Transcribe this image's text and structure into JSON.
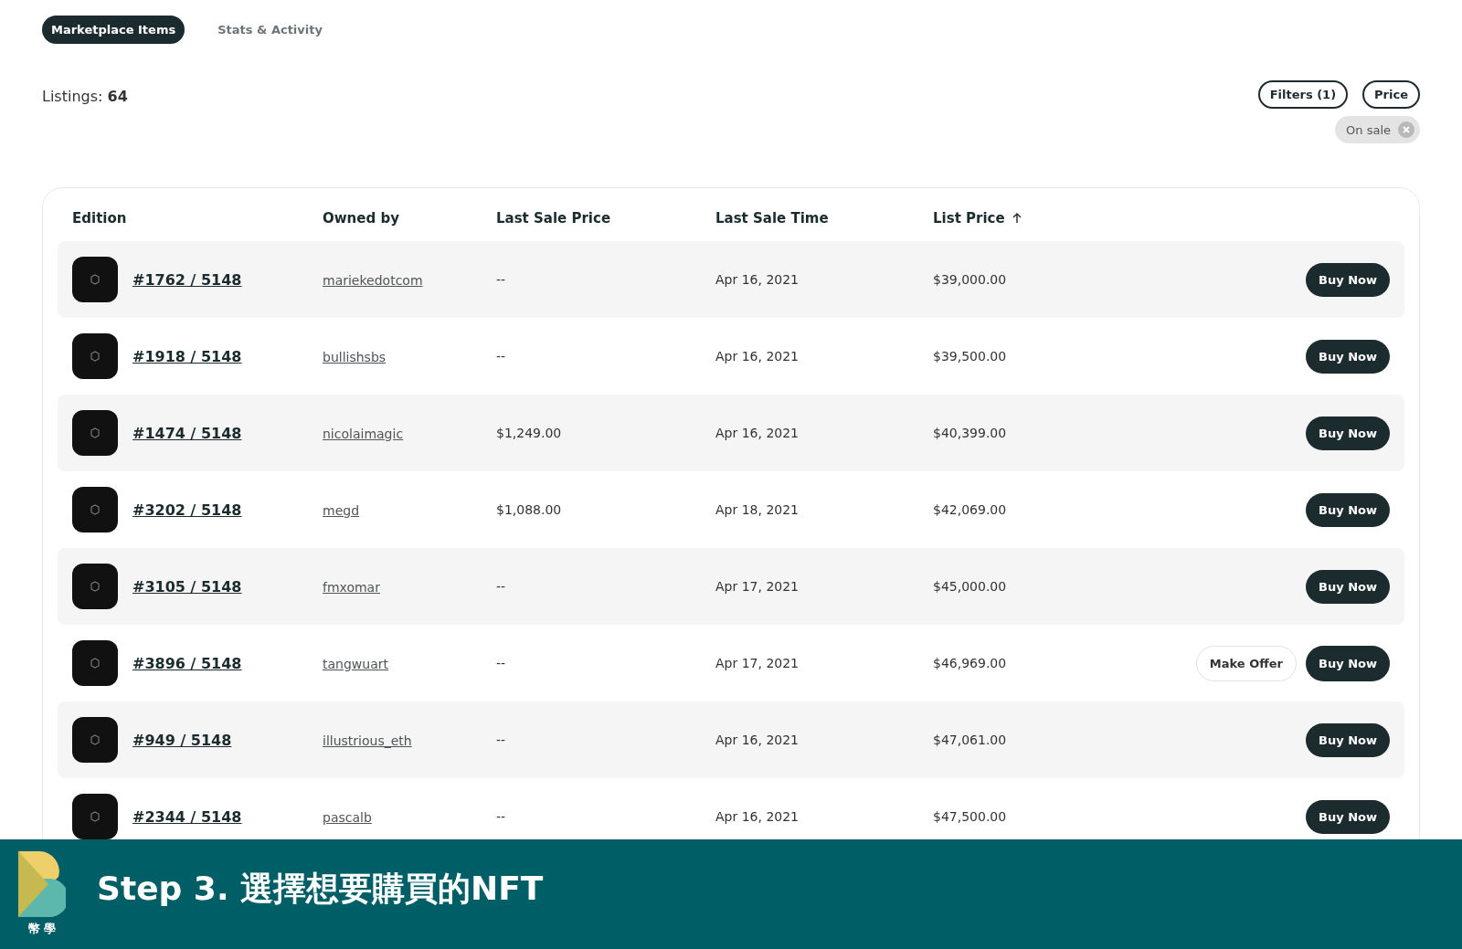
{
  "tabs": [
    {
      "label": "Marketplace Items",
      "selected": true
    },
    {
      "label": "Stats & Activity",
      "selected": false
    }
  ],
  "listings": {
    "label": "Listings:",
    "count": "64"
  },
  "filter_buttons": [
    "Filters (1)",
    "Price"
  ],
  "active_filters": [
    {
      "label": "On sale"
    }
  ],
  "table": {
    "columns": [
      {
        "label": "Edition",
        "sorted": false
      },
      {
        "label": "Owned by",
        "sorted": false
      },
      {
        "label": "Last Sale Price",
        "sorted": false
      },
      {
        "label": "Last Sale Time",
        "sorted": false
      },
      {
        "label": "List Price",
        "sorted": true
      }
    ],
    "rows": [
      {
        "edition": "#1762 / 5148",
        "owner": "mariekedotcom",
        "last_sale_price": "--",
        "last_sale_time": "Apr 16, 2021",
        "list_price": "$39,000.00",
        "actions": [
          {
            "kind": "primary",
            "label": "Buy Now"
          }
        ]
      },
      {
        "edition": "#1918 / 5148",
        "owner": "bullishsbs",
        "last_sale_price": "--",
        "last_sale_time": "Apr 16, 2021",
        "list_price": "$39,500.00",
        "actions": [
          {
            "kind": "primary",
            "label": "Buy Now"
          }
        ]
      },
      {
        "edition": "#1474 / 5148",
        "owner": "nicolaimagic",
        "last_sale_price": "$1,249.00",
        "last_sale_time": "Apr 16, 2021",
        "list_price": "$40,399.00",
        "actions": [
          {
            "kind": "primary",
            "label": "Buy Now"
          }
        ]
      },
      {
        "edition": "#3202 / 5148",
        "owner": "megd",
        "last_sale_price": "$1,088.00",
        "last_sale_time": "Apr 18, 2021",
        "list_price": "$42,069.00",
        "actions": [
          {
            "kind": "primary",
            "label": "Buy Now"
          }
        ]
      },
      {
        "edition": "#3105 / 5148",
        "owner": "fmxomar",
        "last_sale_price": "--",
        "last_sale_time": "Apr 17, 2021",
        "list_price": "$45,000.00",
        "actions": [
          {
            "kind": "primary",
            "label": "Buy Now"
          }
        ]
      },
      {
        "edition": "#3896 / 5148",
        "owner": "tangwuart",
        "last_sale_price": "--",
        "last_sale_time": "Apr 17, 2021",
        "list_price": "$46,969.00",
        "actions": [
          {
            "kind": "outline",
            "label": "Make Offer"
          },
          {
            "kind": "primary",
            "label": "Buy Now"
          }
        ]
      },
      {
        "edition": "#949 / 5148",
        "owner": "illustrious_eth",
        "last_sale_price": "--",
        "last_sale_time": "Apr 16, 2021",
        "list_price": "$47,061.00",
        "actions": [
          {
            "kind": "primary",
            "label": "Buy Now"
          }
        ]
      },
      {
        "edition": "#2344 / 5148",
        "owner": "pascalb",
        "last_sale_price": "--",
        "last_sale_time": "Apr 16, 2021",
        "list_price": "$47,500.00",
        "actions": [
          {
            "kind": "primary",
            "label": "Buy Now"
          }
        ]
      }
    ]
  },
  "caption": {
    "logo_text": "幣 學",
    "title": "Step 3. 選擇想要購買的NFT"
  }
}
